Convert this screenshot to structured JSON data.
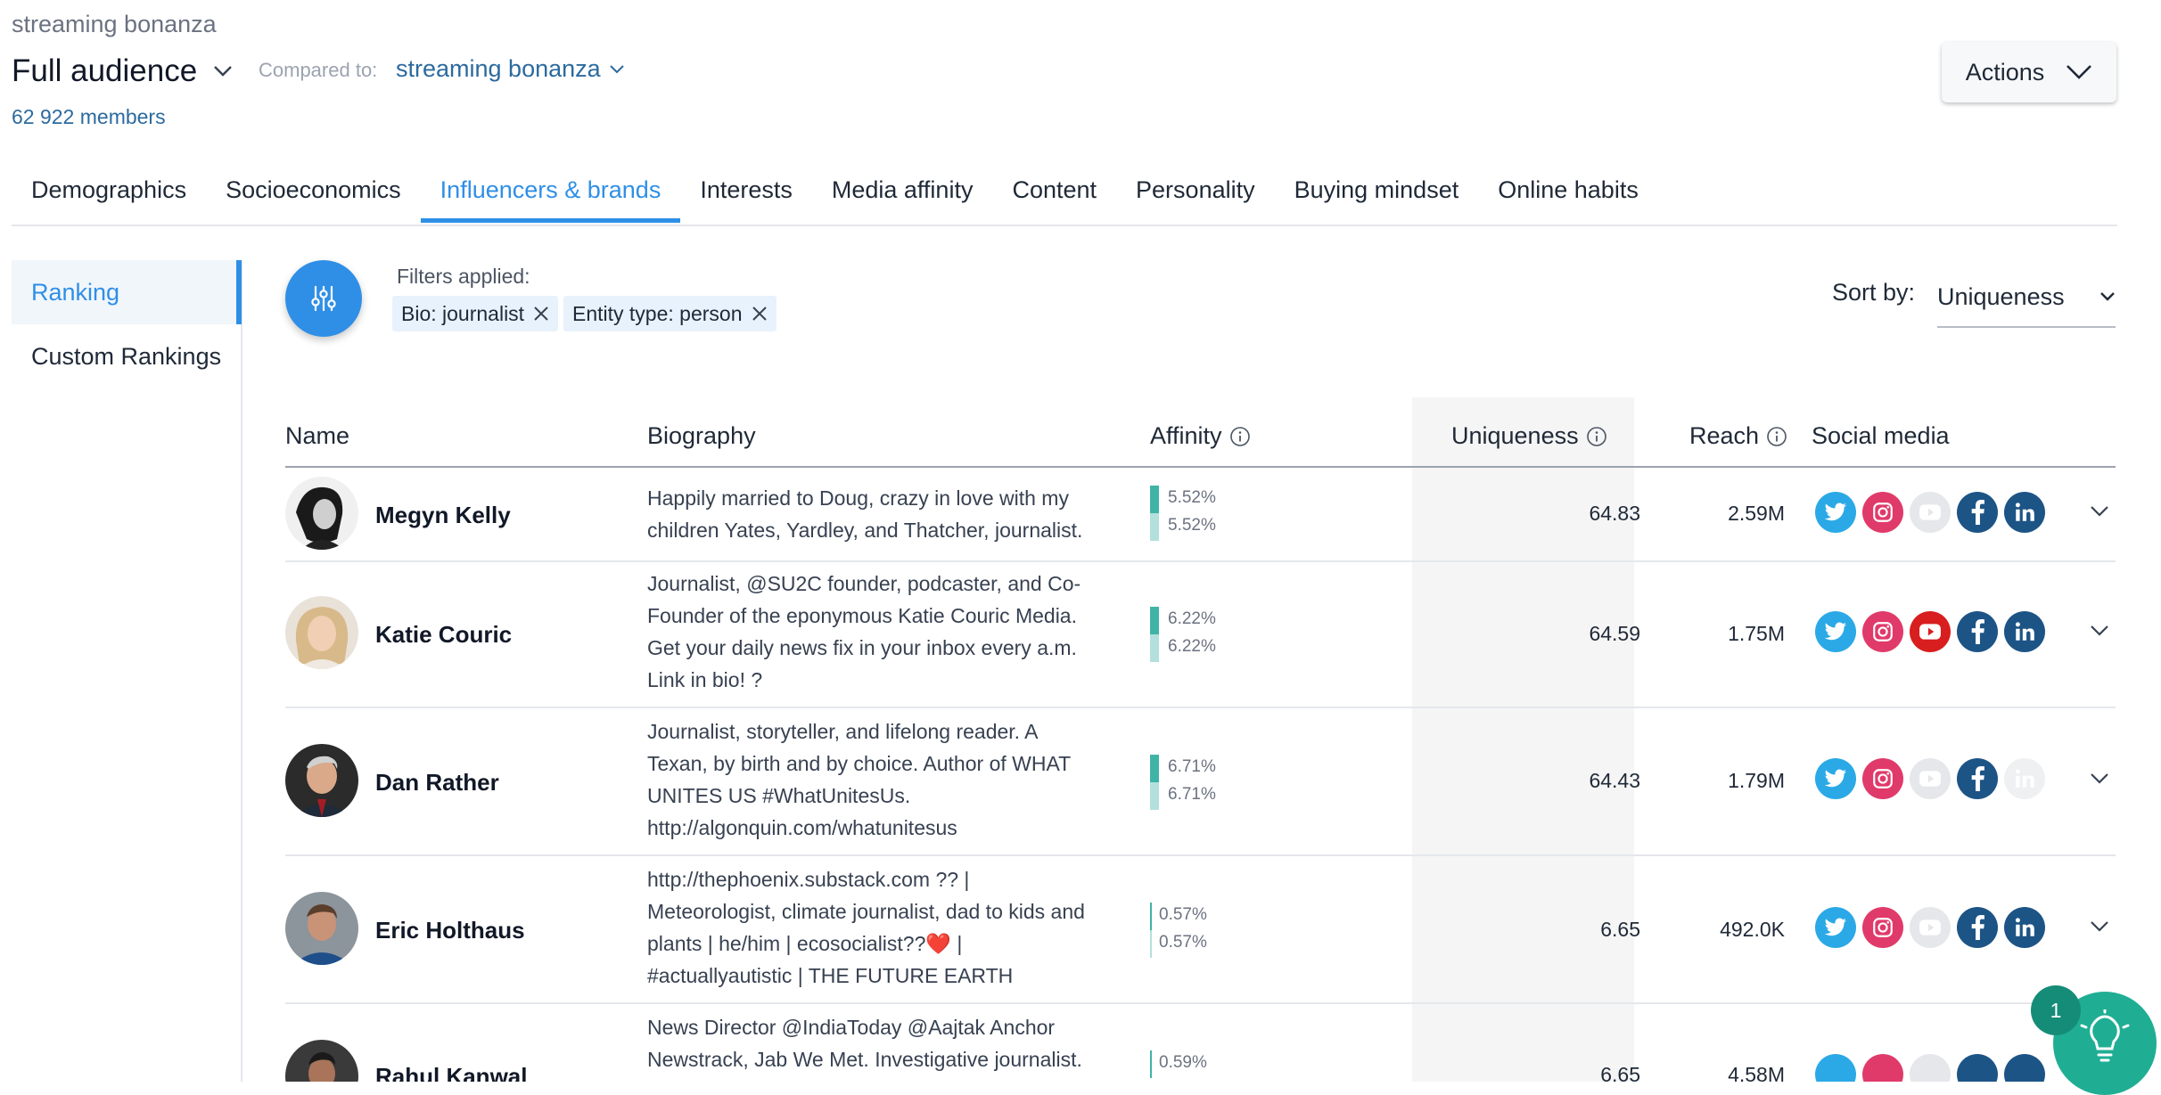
{
  "header": {
    "breadcrumb": "streaming bonanza",
    "audience_title": "Full audience",
    "compared_label": "Compared to:",
    "compared_value": "streaming bonanza",
    "members": "62 922 members",
    "actions_label": "Actions"
  },
  "tabs": [
    {
      "label": "Demographics"
    },
    {
      "label": "Socioeconomics"
    },
    {
      "label": "Influencers & brands"
    },
    {
      "label": "Interests"
    },
    {
      "label": "Media affinity"
    },
    {
      "label": "Content"
    },
    {
      "label": "Personality"
    },
    {
      "label": "Buying mindset"
    },
    {
      "label": "Online habits"
    }
  ],
  "active_tab": "Influencers & brands",
  "sidenav": {
    "items": [
      {
        "label": "Ranking"
      },
      {
        "label": "Custom Rankings"
      }
    ],
    "active": "Ranking"
  },
  "filters": {
    "label": "Filters applied:",
    "chips": [
      {
        "label": "Bio: journalist"
      },
      {
        "label": "Entity type: person"
      }
    ]
  },
  "sort": {
    "label": "Sort by:",
    "value": "Uniqueness"
  },
  "table": {
    "columns": {
      "name": "Name",
      "biography": "Biography",
      "affinity": "Affinity",
      "uniqueness": "Uniqueness",
      "reach": "Reach",
      "social": "Social media"
    },
    "rows": [
      {
        "name": "Megyn Kelly",
        "bio": [
          "Happily married to Doug, crazy in love with my",
          "children Yates, Yardley, and Thatcher, journalist."
        ],
        "affinity": [
          "5.52%",
          "5.52%"
        ],
        "uniqueness": "64.83",
        "reach": "2.59M",
        "social": {
          "twitter": true,
          "instagram": true,
          "youtube": false,
          "facebook": true,
          "linkedin": true
        }
      },
      {
        "name": "Katie Couric",
        "bio": [
          "Journalist, @SU2C founder, podcaster, and Co-",
          "Founder of the eponymous Katie Couric Media.",
          "Get your daily news fix in your inbox every a.m.",
          "Link in bio! ?"
        ],
        "affinity": [
          "6.22%",
          "6.22%"
        ],
        "uniqueness": "64.59",
        "reach": "1.75M",
        "social": {
          "twitter": true,
          "instagram": true,
          "youtube": true,
          "facebook": true,
          "linkedin": true
        }
      },
      {
        "name": "Dan Rather",
        "bio": [
          "Journalist, storyteller, and lifelong reader. A",
          "Texan, by birth and by choice. Author of WHAT",
          "UNITES US #WhatUnitesUs.",
          "http://algonquin.com/whatunitesus"
        ],
        "affinity": [
          "6.71%",
          "6.71%"
        ],
        "uniqueness": "64.43",
        "reach": "1.79M",
        "social": {
          "twitter": true,
          "instagram": true,
          "youtube": false,
          "facebook": true,
          "linkedin": false
        }
      },
      {
        "name": "Eric Holthaus",
        "bio": [
          "http://thephoenix.substack.com ?? |",
          "Meteorologist, climate journalist, dad to kids and",
          "plants | he/him | ecosocialist??❤️  |",
          "#actuallyautistic | THE FUTURE EARTH"
        ],
        "affinity": [
          "0.57%",
          "0.57%"
        ],
        "uniqueness": "6.65",
        "reach": "492.0K",
        "social": {
          "twitter": true,
          "instagram": true,
          "youtube": false,
          "facebook": true,
          "linkedin": true
        }
      },
      {
        "name": "Rahul Kanwal",
        "bio": [
          "News Director @IndiaToday @Aajtak Anchor",
          "Newstrack, Jab We Met. Investigative journalist."
        ],
        "affinity": [
          "0.59%",
          ""
        ],
        "uniqueness": "6.65",
        "reach": "4.58M",
        "social": {
          "twitter": true,
          "instagram": true,
          "youtube": false,
          "facebook": true,
          "linkedin": true
        }
      }
    ]
  },
  "help": {
    "badge": "1"
  },
  "colors": {
    "accent": "#2f8fe6",
    "affinity_bar": "#3fb4a6",
    "affinity_bar_light": "#b3e0dc",
    "twitter": "#2ba9e6",
    "instagram": "#e03a6b",
    "youtube": "#d81e1e",
    "facebook": "#1d5486",
    "linkedin": "#1d5486",
    "disabled_icon": "#e5e7eb",
    "help_fab": "#1fae94"
  }
}
